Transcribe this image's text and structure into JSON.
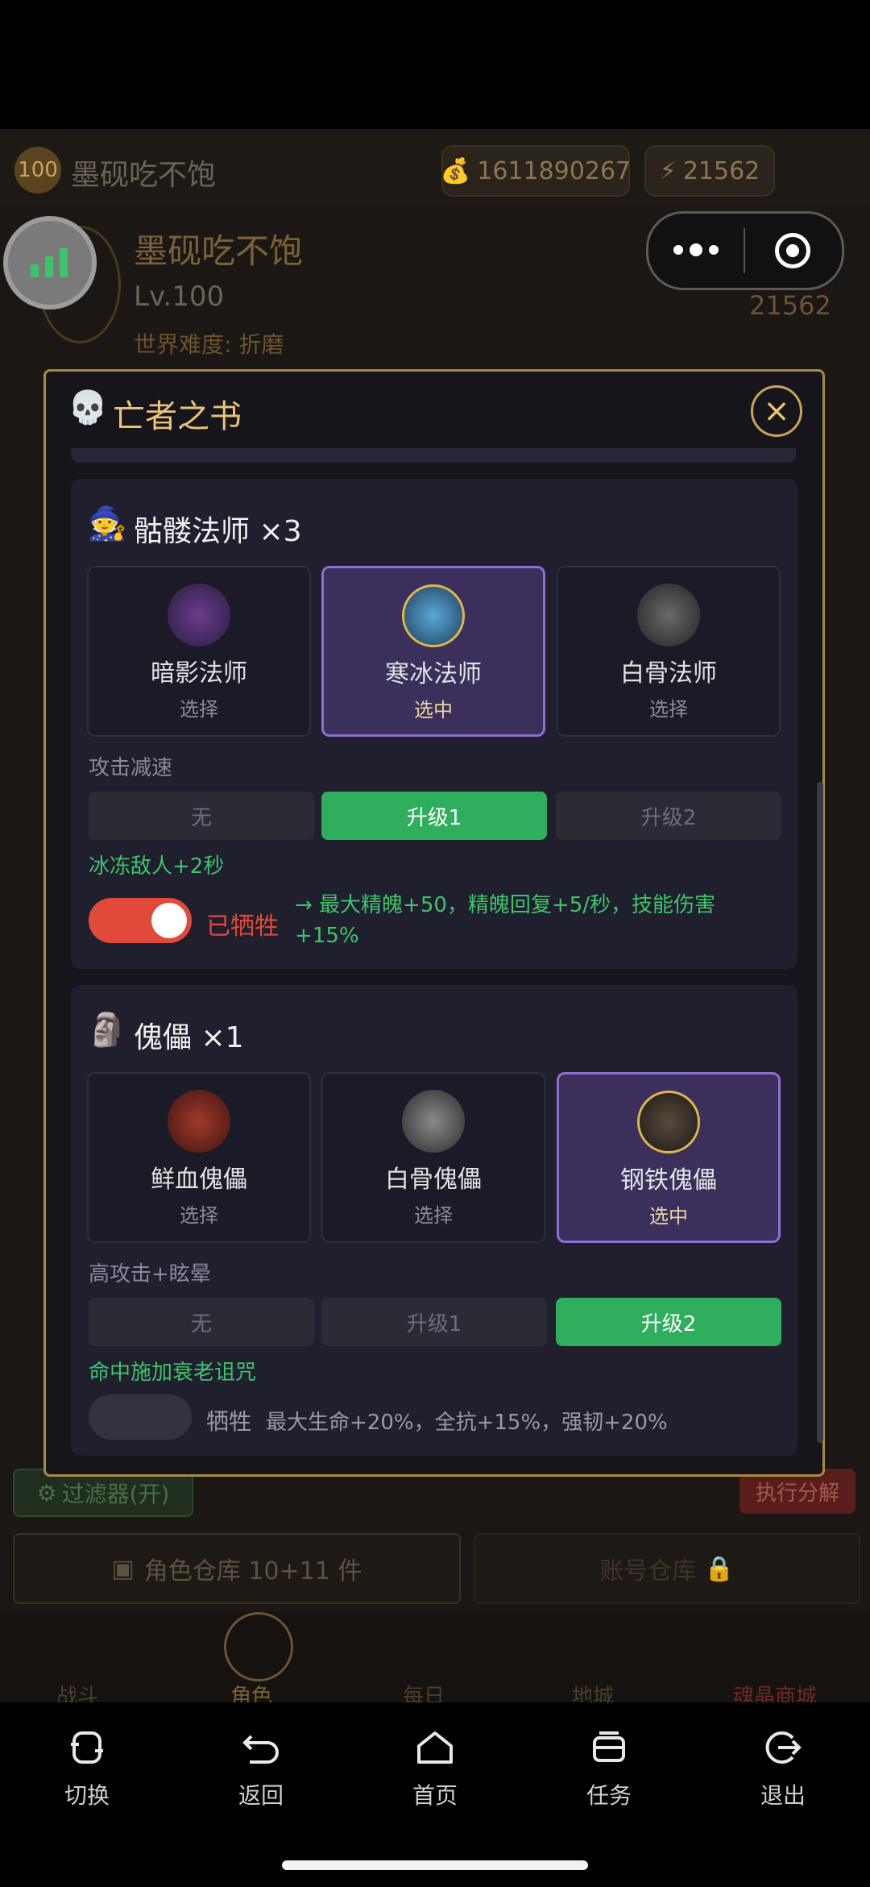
{
  "header": {
    "level_badge": "100",
    "player_name": "墨砚吃不饱",
    "gold": "1611890267",
    "energy": "21562"
  },
  "profile": {
    "name": "墨砚吃不饱",
    "level": "Lv.100",
    "difficulty": "世界难度: 折磨",
    "energy": "21562"
  },
  "modal": {
    "title": "亡者之书",
    "sections": [
      {
        "title": "骷髅法师 ×3",
        "cards": [
          {
            "name": "暗影法师",
            "status": "选择"
          },
          {
            "name": "寒冰法师",
            "status": "选中"
          },
          {
            "name": "白骨法师",
            "status": "选择"
          }
        ],
        "passive_label": "攻击减速",
        "upgrades": [
          "无",
          "升级1",
          "升级2"
        ],
        "upgrade_effect": "冰冻敌人+2秒",
        "sacrifice_label": "已牺牲",
        "sacrifice_desc": "→ 最大精魄+50，精魄回复+5/秒，技能伤害+15%"
      },
      {
        "title": "傀儡 ×1",
        "cards": [
          {
            "name": "鲜血傀儡",
            "status": "选择"
          },
          {
            "name": "白骨傀儡",
            "status": "选择"
          },
          {
            "name": "钢铁傀儡",
            "status": "选中"
          }
        ],
        "passive_label": "高攻击+眩晕",
        "upgrades": [
          "无",
          "升级1",
          "升级2"
        ],
        "upgrade_effect": "命中施加衰老诅咒",
        "sacrifice_label": "牺牲",
        "sacrifice_desc": "最大生命+20%，全抗+15%，强韧+20%"
      }
    ]
  },
  "background_ui": {
    "filter_button": "过滤器(开)",
    "execute_button": "执行分解",
    "storage_button": "角色仓库 10+11 件",
    "account_storage": "账号仓库",
    "tabs": [
      "战斗",
      "角色",
      "每日",
      "地城",
      "魂晶商城"
    ]
  },
  "navbar": {
    "items": [
      {
        "label": "切换",
        "icon": "switch-icon"
      },
      {
        "label": "返回",
        "icon": "back-icon"
      },
      {
        "label": "首页",
        "icon": "home-icon"
      },
      {
        "label": "任务",
        "icon": "tasks-icon"
      },
      {
        "label": "退出",
        "icon": "exit-icon"
      }
    ]
  },
  "colors": {
    "accent_gold": "#e9c475",
    "selected_purple": "#3b2f5c",
    "active_green": "#2fae5e",
    "sacrifice_red": "#e04a3a"
  }
}
